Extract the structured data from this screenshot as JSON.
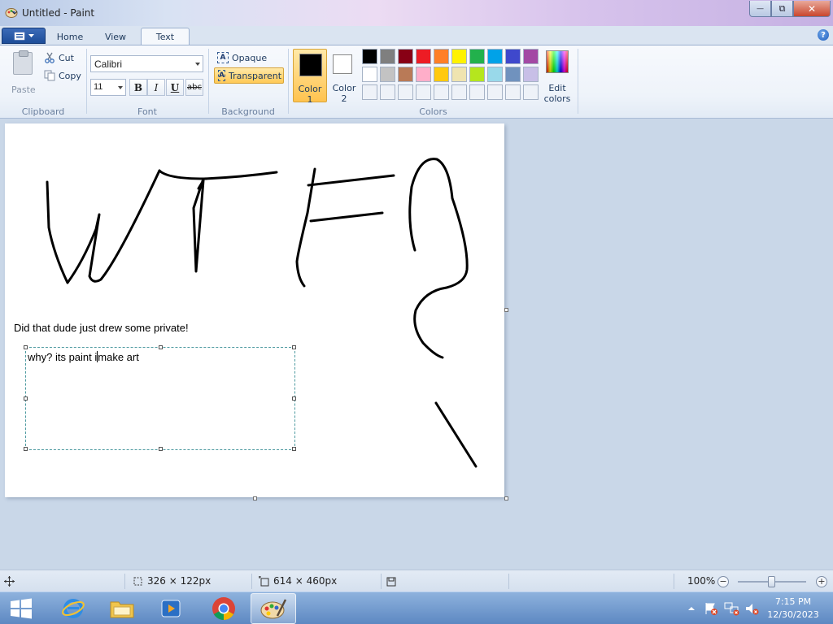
{
  "window": {
    "title": "Untitled - Paint",
    "minimize_glyph": "—",
    "maximize_glyph": "⧉",
    "close_glyph": "✕"
  },
  "ribbon_tabs": [
    {
      "label": "Home"
    },
    {
      "label": "View"
    },
    {
      "label": "Text",
      "active": true
    }
  ],
  "help_glyph": "?",
  "clipboard": {
    "group_label": "Clipboard",
    "paste_label": "Paste",
    "cut_label": "Cut",
    "copy_label": "Copy"
  },
  "font": {
    "group_label": "Font",
    "family": "Calibri",
    "size": "11",
    "bold_label": "B",
    "italic_label": "I",
    "underline_label": "U",
    "strike_label": "abc"
  },
  "background": {
    "group_label": "Background",
    "opaque_label": "Opaque",
    "transparent_label": "Transparent",
    "icon_letter": "A",
    "selected": "Transparent"
  },
  "colors": {
    "group_label": "Colors",
    "color1_label_1": "Color",
    "color1_label_2": "1",
    "color2_label_1": "Color",
    "color2_label_2": "2",
    "color1_value": "#000000",
    "color2_value": "#ffffff",
    "edit_label_1": "Edit",
    "edit_label_2": "colors",
    "palette_row1": [
      "#000000",
      "#7f7f7f",
      "#880015",
      "#ed1c24",
      "#ff7f27",
      "#fff200",
      "#22b14c",
      "#00a2e8",
      "#3f48cc",
      "#a349a4"
    ],
    "palette_row2": [
      "#ffffff",
      "#c3c3c3",
      "#b97a57",
      "#ffaec9",
      "#ffc90e",
      "#efe4b0",
      "#b5e61d",
      "#99d9ea",
      "#7092be",
      "#c8bfe7"
    ],
    "palette_row3_empty": 10
  },
  "canvas": {
    "static_text": "Did that dude just drew some private!",
    "textbox_before_caret": "why? its paint i",
    "textbox_after_caret": "make art"
  },
  "status": {
    "selection_size": "326 × 122px",
    "canvas_size": "614 × 460px",
    "zoom": "100%",
    "zoom_out_glyph": "−",
    "zoom_in_glyph": "+",
    "zoom_fraction": 0.5
  },
  "taskbar": {
    "apps": [
      "internet-explorer",
      "file-explorer",
      "media-player",
      "chrome",
      "paint"
    ],
    "active_app": "paint",
    "time": "7:15 PM",
    "date": "12/30/2023"
  }
}
